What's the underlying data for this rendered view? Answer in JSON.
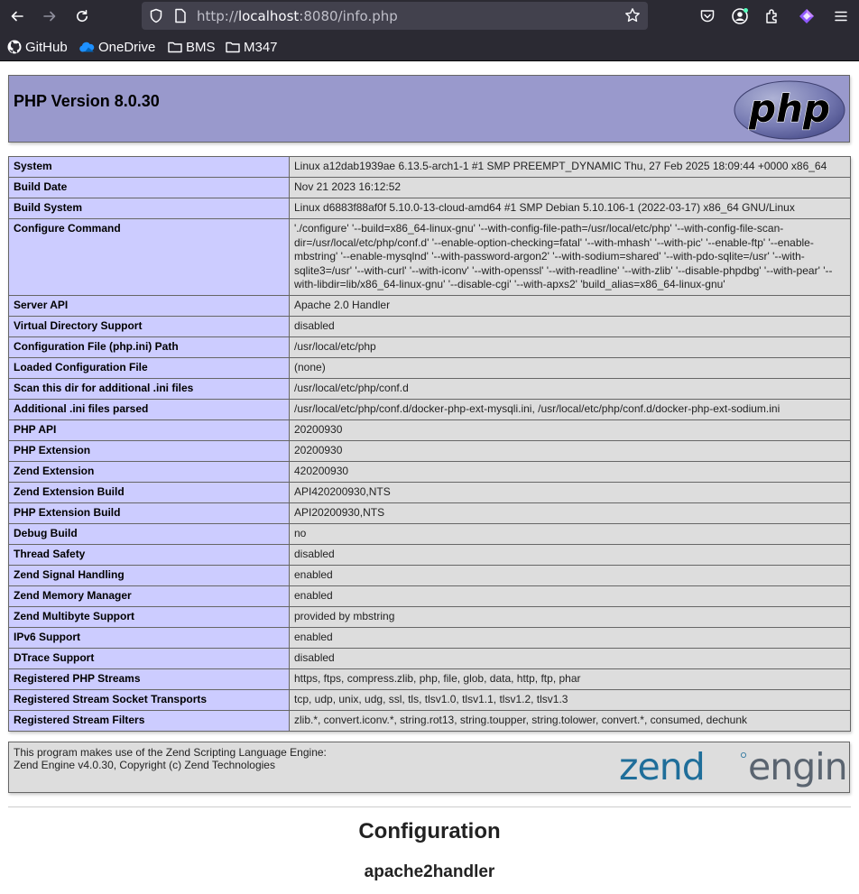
{
  "browser": {
    "url_prefix": "http://",
    "url_host": "localhost",
    "url_suffix": ":8080/info.php",
    "bookmarks": [
      {
        "label": "GitHub",
        "icon": "github-icon"
      },
      {
        "label": "OneDrive",
        "icon": "onedrive-icon"
      },
      {
        "label": "BMS",
        "icon": "folder-icon"
      },
      {
        "label": "M347",
        "icon": "folder-icon"
      }
    ],
    "colors": {
      "chrome": "#2b2a33",
      "urlbar": "#42414d"
    }
  },
  "header": {
    "title": "PHP Version 8.0.30",
    "logo_text": "php"
  },
  "info_rows": [
    {
      "key": "System",
      "value": "Linux a12dab1939ae 6.13.5-arch1-1 #1 SMP PREEMPT_DYNAMIC Thu, 27 Feb 2025 18:09:44 +0000 x86_64"
    },
    {
      "key": "Build Date",
      "value": "Nov 21 2023 16:12:52"
    },
    {
      "key": "Build System",
      "value": "Linux d6883f88af0f 5.10.0-13-cloud-amd64 #1 SMP Debian 5.10.106-1 (2022-03-17) x86_64 GNU/Linux"
    },
    {
      "key": "Configure Command",
      "value": "'./configure' '--build=x86_64-linux-gnu' '--with-config-file-path=/usr/local/etc/php' '--with-config-file-scan-dir=/usr/local/etc/php/conf.d' '--enable-option-checking=fatal' '--with-mhash' '--with-pic' '--enable-ftp' '--enable-mbstring' '--enable-mysqlnd' '--with-password-argon2' '--with-sodium=shared' '--with-pdo-sqlite=/usr' '--with-sqlite3=/usr' '--with-curl' '--with-iconv' '--with-openssl' '--with-readline' '--with-zlib' '--disable-phpdbg' '--with-pear' '--with-libdir=lib/x86_64-linux-gnu' '--disable-cgi' '--with-apxs2' 'build_alias=x86_64-linux-gnu'"
    },
    {
      "key": "Server API",
      "value": "Apache 2.0 Handler"
    },
    {
      "key": "Virtual Directory Support",
      "value": "disabled"
    },
    {
      "key": "Configuration File (php.ini) Path",
      "value": "/usr/local/etc/php"
    },
    {
      "key": "Loaded Configuration File",
      "value": "(none)"
    },
    {
      "key": "Scan this dir for additional .ini files",
      "value": "/usr/local/etc/php/conf.d"
    },
    {
      "key": "Additional .ini files parsed",
      "value": "/usr/local/etc/php/conf.d/docker-php-ext-mysqli.ini, /usr/local/etc/php/conf.d/docker-php-ext-sodium.ini"
    },
    {
      "key": "PHP API",
      "value": "20200930"
    },
    {
      "key": "PHP Extension",
      "value": "20200930"
    },
    {
      "key": "Zend Extension",
      "value": "420200930"
    },
    {
      "key": "Zend Extension Build",
      "value": "API420200930,NTS"
    },
    {
      "key": "PHP Extension Build",
      "value": "API20200930,NTS"
    },
    {
      "key": "Debug Build",
      "value": "no"
    },
    {
      "key": "Thread Safety",
      "value": "disabled"
    },
    {
      "key": "Zend Signal Handling",
      "value": "enabled"
    },
    {
      "key": "Zend Memory Manager",
      "value": "enabled"
    },
    {
      "key": "Zend Multibyte Support",
      "value": "provided by mbstring"
    },
    {
      "key": "IPv6 Support",
      "value": "enabled"
    },
    {
      "key": "DTrace Support",
      "value": "disabled"
    },
    {
      "key": "Registered PHP Streams",
      "value": "https, ftps, compress.zlib, php, file, glob, data, http, ftp, phar"
    },
    {
      "key": "Registered Stream Socket Transports",
      "value": "tcp, udp, unix, udg, ssl, tls, tlsv1.0, tlsv1.1, tlsv1.2, tlsv1.3"
    },
    {
      "key": "Registered Stream Filters",
      "value": "zlib.*, convert.iconv.*, string.rot13, string.toupper, string.tolower, convert.*, consumed, dechunk"
    }
  ],
  "zend": {
    "line1": "This program makes use of the Zend Scripting Language Engine:",
    "line2": "Zend Engine v4.0.30, Copyright (c) Zend Technologies",
    "logo_word1": "zend",
    "logo_word2": "engine"
  },
  "sections": {
    "configuration": "Configuration",
    "apache": "apache2handler"
  },
  "colors": {
    "header_bg": "#9999cc",
    "key_bg": "#ccccff",
    "value_bg": "#dddddd",
    "zend_blue": "#1f6e9a",
    "zend_gray": "#5a6470"
  }
}
